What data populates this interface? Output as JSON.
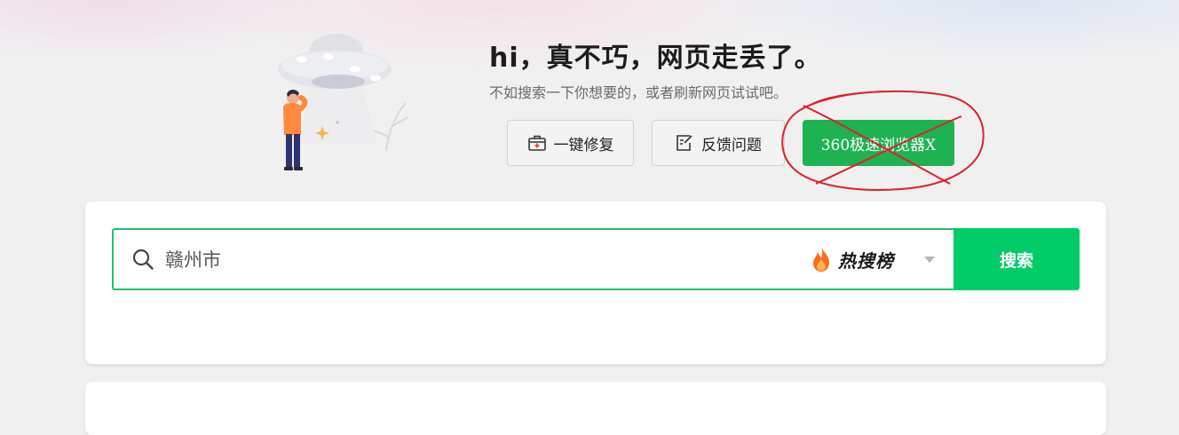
{
  "error_page": {
    "title": "hi，真不巧，网页走丢了。",
    "subtitle": "不如搜索一下你想要的，或者刷新网页试试吧。"
  },
  "actions": {
    "repair_label": "一键修复",
    "feedback_label": "反馈问题",
    "browser_label": "360极速浏览器X"
  },
  "search": {
    "query": "赣州市",
    "hot_list_label": "热搜榜",
    "submit_label": "搜索"
  },
  "icons": {
    "repair": "first-aid-kit-icon",
    "feedback": "edit-note-icon",
    "search": "magnifier-icon",
    "hot": "flame-icon",
    "dropdown": "caret-down-icon"
  },
  "colors": {
    "accent_green": "#00cc6a",
    "browser_button": "#1fb252",
    "scribble_red": "#e0202a"
  }
}
